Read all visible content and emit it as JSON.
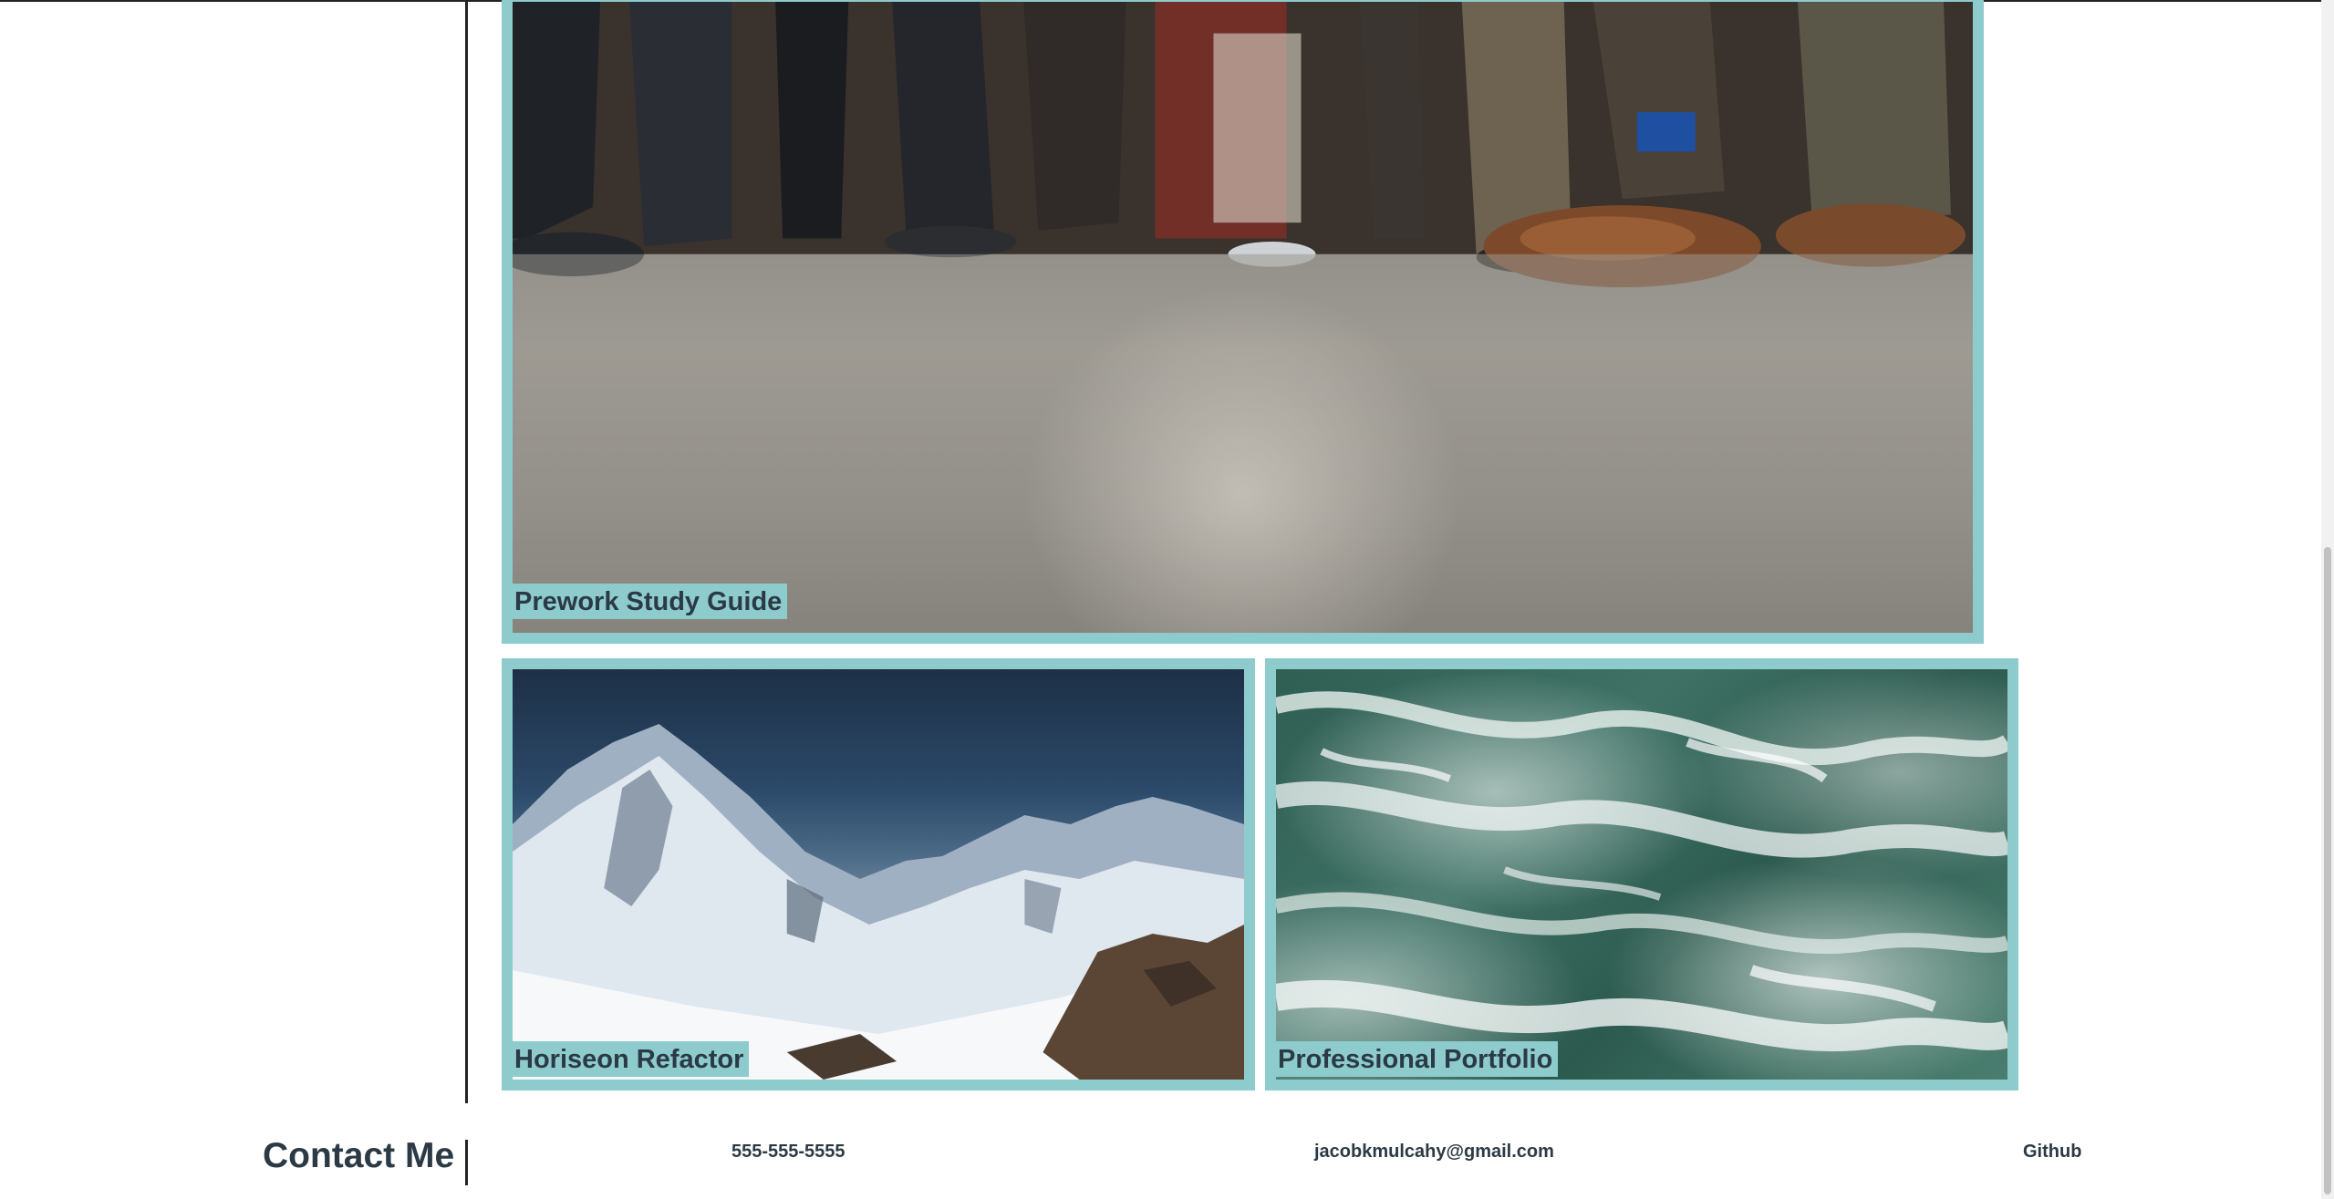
{
  "projects": [
    {
      "title": "Prework Study Guide",
      "image_icon": "bus-passengers-photo"
    },
    {
      "title": "Horiseon Refactor",
      "image_icon": "snowy-mountains-photo"
    },
    {
      "title": "Professional Portfolio",
      "image_icon": "ocean-waves-photo"
    }
  ],
  "contact": {
    "heading": "Contact Me",
    "phone": "555-555-5555",
    "email": "jacobkmulcahy@gmail.com",
    "github": "Github"
  },
  "colors": {
    "card_border": "#8dcbcd",
    "text": "#2b3a45"
  }
}
